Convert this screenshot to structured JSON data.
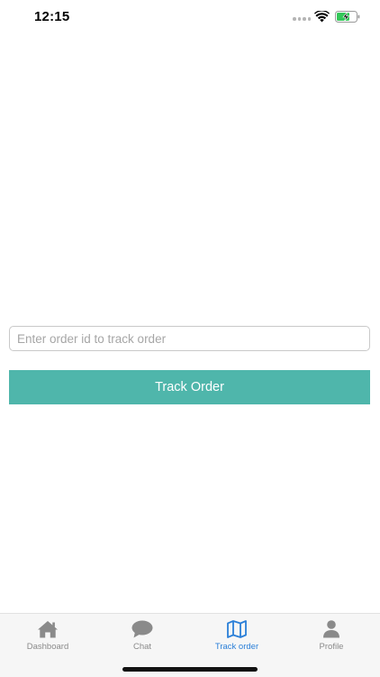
{
  "status_bar": {
    "time": "12:15"
  },
  "icons": {
    "wifi": "wifi-icon",
    "battery": "battery-charging-icon",
    "dashboard": "home-icon",
    "chat": "chat-bubble-icon",
    "track": "map-icon",
    "profile": "person-icon"
  },
  "track_form": {
    "input_value": "",
    "input_placeholder": "Enter order id to track order",
    "button_label": "Track Order"
  },
  "tab_bar": {
    "items": [
      {
        "label": "Dashboard",
        "active": false
      },
      {
        "label": "Chat",
        "active": false
      },
      {
        "label": "Track order",
        "active": true
      },
      {
        "label": "Profile",
        "active": false
      }
    ]
  },
  "colors": {
    "accent_button": "#4fb6ab",
    "active_tab": "#2a7fd8",
    "inactive_tab": "#8a8a8a",
    "battery_fill": "#34c759"
  }
}
